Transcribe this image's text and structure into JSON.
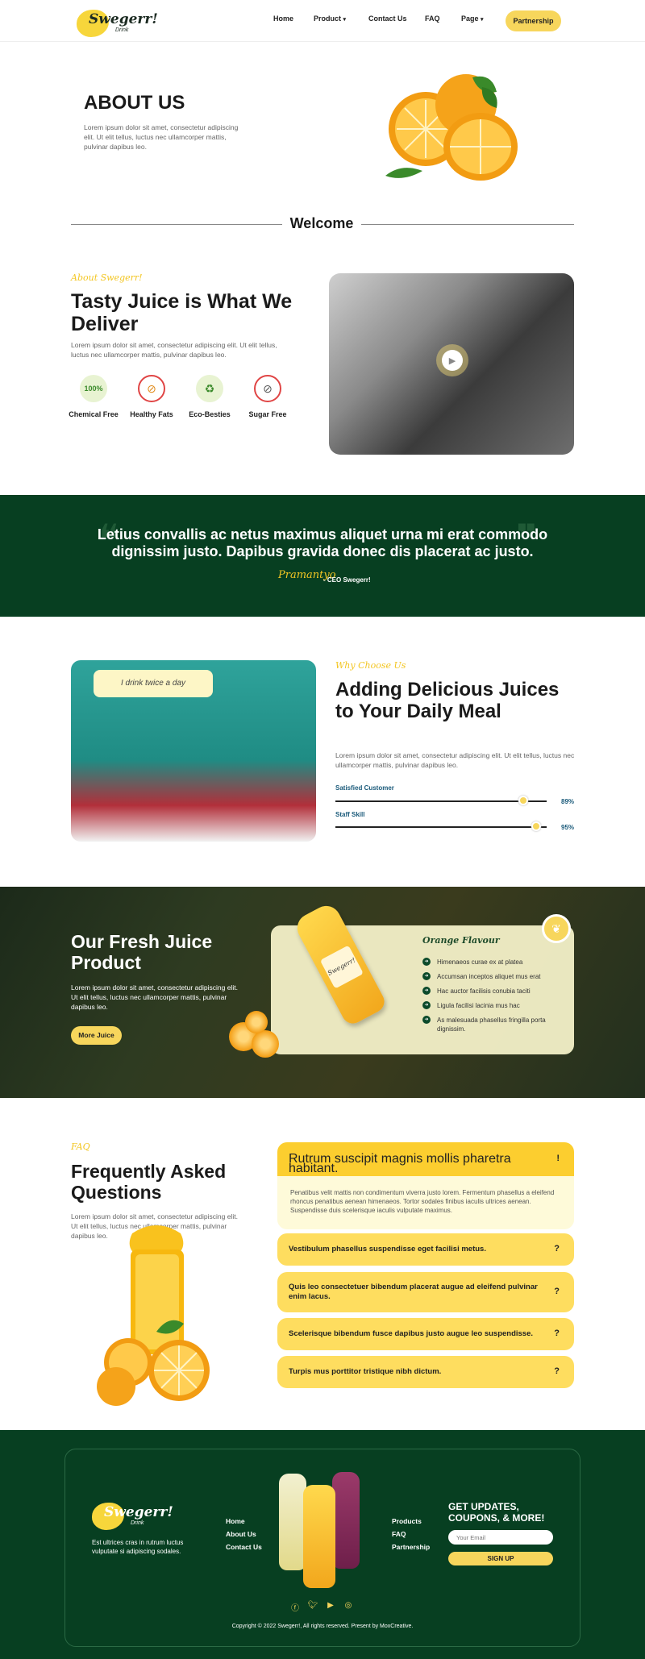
{
  "header": {
    "logo_text": "Swegerr!",
    "logo_sub": "Drink",
    "nav": [
      "Home",
      "Product",
      "Contact Us",
      "FAQ",
      "Page"
    ],
    "cta": "Partnership"
  },
  "hero": {
    "title": "ABOUT US",
    "text": "Lorem ipsum dolor sit amet, consectetur adipiscing elit. Ut elit tellus, luctus nec ullamcorper mattis, pulvinar dapibus leo.",
    "divider": "Welcome"
  },
  "tasty": {
    "eyebrow": "About Swegerr!",
    "title": "Tasty Juice is What We Deliver",
    "text": "Lorem ipsum dolor sit amet, consectetur adipiscing elit. Ut elit tellus, luctus nec ullamcorper mattis, pulvinar dapibus leo.",
    "features": [
      {
        "label": "Chemical Free",
        "icon": "leaf-100-icon"
      },
      {
        "label": "Healthy Fats",
        "icon": "no-fat-icon"
      },
      {
        "label": "Eco-Besties",
        "icon": "recycle-icon"
      },
      {
        "label": "Sugar Free",
        "icon": "no-sugar-icon"
      }
    ]
  },
  "quote": {
    "text": "Letius convallis ac netus maximus aliquet urna mi erat commodo dignissim justo. Dapibus gravida donec dis placerat ac justo.",
    "signature": "Pramantyo",
    "role": "- CEO Swegerr!"
  },
  "why": {
    "bubble": "I drink twice a day",
    "eyebrow": "Why Choose Us",
    "title": "Adding Delicious Juices to Your Daily Meal",
    "text": "Lorem ipsum dolor sit amet, consectetur adipiscing elit. Ut elit tellus, luctus nec ullamcorper mattis, pulvinar dapibus leo.",
    "skills": [
      {
        "label": "Satisfied Customer",
        "percent": "89%",
        "value": 0.89
      },
      {
        "label": "Staff Skill",
        "percent": "95%",
        "value": 0.95
      }
    ]
  },
  "product": {
    "title": "Our Fresh Juice Product",
    "text": "Lorem ipsum dolor sit amet, consectetur adipiscing elit. Ut elit tellus, luctus nec ullamcorper mattis, pulvinar dapibus leo.",
    "button": "More Juice",
    "bottle_label": "Swegerr!",
    "flavour_title": "Orange Flavour",
    "flavours": [
      "Himenaeos curae ex at platea",
      "Accumsan inceptos aliquet mus erat",
      "Hac auctor facilisis conubia taciti",
      "Ligula facilisi lacinia mus hac",
      "As malesuada phasellus fringilla porta dignissim."
    ]
  },
  "faq": {
    "eyebrow": "FAQ",
    "title": "Frequently Asked Questions",
    "text": "Lorem ipsum dolor sit amet, consectetur adipiscing elit. Ut elit tellus, luctus nec ullamcorper mattis, pulvinar dapibus leo.",
    "open_question": "Rutrum suscipit magnis mollis pharetra habitant.",
    "open_answer": "Penatibus velit mattis non condimentum viverra justo lorem. Fermentum phasellus a eleifend rhoncus penatibus aenean himenaeos. Tortor sodales finibus iaculis ultrices aenean. Suspendisse duis scelerisque iaculis vulputate maximus.",
    "open_symbol": "!",
    "questions": [
      "Vestibulum phasellus suspendisse eget facilisi metus.",
      "Quis leo consectetuer bibendum placerat augue ad eleifend pulvinar enim lacus.",
      "Scelerisque bibendum fusce dapibus justo augue leo suspendisse.",
      "Turpis mus porttitor tristique nibh dictum."
    ],
    "closed_symbol": "?"
  },
  "footer": {
    "logo_text": "Swegerr!",
    "logo_sub": "Drink",
    "text": "Est ultrices cras in rutrum luctus vulputate si adipiscing sodales.",
    "links_left": [
      "Home",
      "About Us",
      "Contact Us"
    ],
    "links_right": [
      "Products",
      "FAQ",
      "Partnership"
    ],
    "updates_title": "GET UPDATES, COUPONS, & MORE!",
    "email_placeholder": "Your Email",
    "signup": "SIGN UP",
    "socials": [
      "facebook-icon",
      "twitter-icon",
      "youtube-icon",
      "instagram-icon"
    ],
    "copyright": "Copyright © 2022 Swegerr!, All rights reserved. Present by MoxCreative."
  },
  "colors": {
    "brand_yellow": "#f7d65c",
    "dark_green": "#073f21",
    "accent_gold": "#f3c623"
  }
}
